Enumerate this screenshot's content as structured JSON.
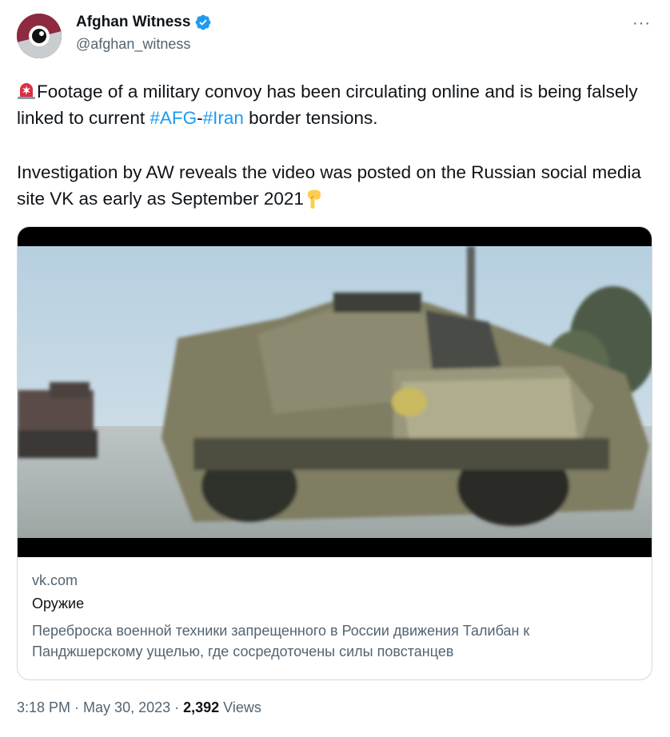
{
  "author": {
    "name": "Afghan Witness",
    "handle": "@afghan_witness",
    "verified_icon": "verified-badge-icon",
    "avatar_icon": "eye-logo-icon"
  },
  "more_label": "···",
  "tweet": {
    "line1_pre": "Footage of a military convoy has been circulating online and is being falsely linked to current ",
    "hashtag1": "#AFG",
    "dash": "-",
    "hashtag2": "#Iran",
    "line1_post": " border tensions.",
    "line2": "Investigation by AW reveals the video was posted on the Russian social media site VK as early as September 2021",
    "lead_emoji": "siren-icon",
    "trail_emoji": "pointing-down-icon"
  },
  "card": {
    "domain": "vk.com",
    "title": "Оружие",
    "description": "Переброска военной техники запрещенного в России движения Талибан к Панджшерскому ущелью, где сосредоточены силы повстанцев"
  },
  "meta": {
    "time": "3:18 PM",
    "sep1": " · ",
    "date": "May 30, 2023",
    "sep2": " · ",
    "views_count": "2,392",
    "views_label": " Views"
  },
  "colors": {
    "hashtag": "#1d9bf0",
    "verified": "#1d9bf0",
    "secondary_text": "#536471",
    "border": "#cfd9de",
    "avatar": "#8d2a3f"
  }
}
